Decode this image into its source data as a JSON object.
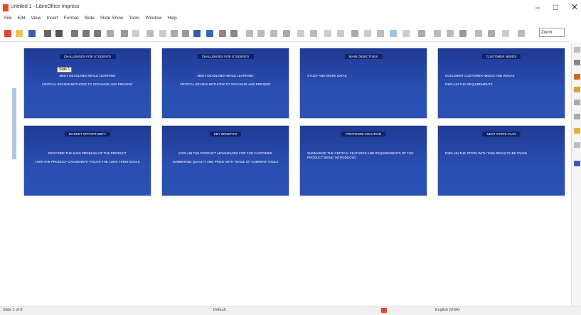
{
  "window": {
    "title": "Untitled 1 - LibreOffice Impress",
    "app_icon": "impress-app-icon",
    "controls": [
      "–",
      "□",
      "✕"
    ]
  },
  "menu": [
    "File",
    "Edit",
    "View",
    "Insert",
    "Format",
    "Slide",
    "Slide Show",
    "Tools",
    "Window",
    "Help"
  ],
  "toolbar": {
    "zoom": "Zoom"
  },
  "slides": [
    {
      "title": "Challenges for Students",
      "body": [
        "Meet Deadlines While Learning",
        "Critical Review Methods to Organize and Present"
      ],
      "tooltip": "Slide 1"
    },
    {
      "title": "Challenges for Students",
      "body": [
        "Meet Deadlines While Learning",
        "Critical Review Methods to Organize and Present"
      ]
    },
    {
      "title": "Main Objectives",
      "body": [
        "Study and Work Ideas"
      ]
    },
    {
      "title": "Customer Needs",
      "body": [
        "Document Customer Needs and Wants",
        "Explain the Requirements"
      ]
    },
    {
      "title": "Market Opportunity",
      "body": [
        "Describe the Main Problem of the Product",
        "How the Product Can Benefit You In The Long Term Goals"
      ]
    },
    {
      "title": "Key Benefits",
      "body": [
        "Explain the Product Advantages for the Customer",
        "Summarize Quality and Price with Trade of Current Tools"
      ]
    },
    {
      "title": "Proposed Solution",
      "body": [
        "Summarize the Critical Features and Requirements of the Product Being Introduced"
      ]
    },
    {
      "title": "Next Steps Plan",
      "body": [
        "Explain the Steps with Task Results Be Taken"
      ]
    }
  ],
  "status": {
    "slide": "Slide 1 of 8",
    "layout": "Default",
    "language": "English (USA)"
  },
  "colors": {
    "slide_bg": "#2a4fb3",
    "title_bg": "#10236a",
    "accent": "#e8452c"
  }
}
